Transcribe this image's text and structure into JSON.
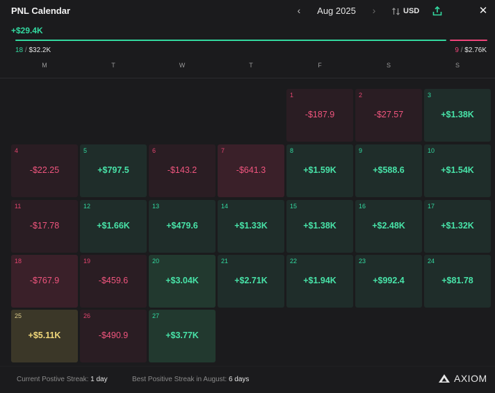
{
  "header": {
    "title": "PNL Calendar",
    "month": "Aug 2025",
    "prev_icon": "chevron-left-icon",
    "next_icon": "chevron-right-icon",
    "currency": "USD",
    "close_icon": "close-icon"
  },
  "summary": {
    "total": "+$29.4K",
    "win_days": "18",
    "win_amount": "$32.2K",
    "loss_days": "9",
    "loss_amount": "$2.76K",
    "sep": " / "
  },
  "weekdays": [
    "M",
    "T",
    "W",
    "T",
    "F",
    "S",
    "S"
  ],
  "days": [
    {
      "day": "1",
      "value": "-$187.9",
      "type": "neg"
    },
    {
      "day": "2",
      "value": "-$27.57",
      "type": "neg"
    },
    {
      "day": "3",
      "value": "+$1.38K",
      "type": "pos"
    },
    {
      "day": "4",
      "value": "-$22.25",
      "type": "neg"
    },
    {
      "day": "5",
      "value": "+$797.5",
      "type": "pos"
    },
    {
      "day": "6",
      "value": "-$143.2",
      "type": "neg"
    },
    {
      "day": "7",
      "value": "-$641.3",
      "type": "neg-strong"
    },
    {
      "day": "8",
      "value": "+$1.59K",
      "type": "pos"
    },
    {
      "day": "9",
      "value": "+$588.6",
      "type": "pos"
    },
    {
      "day": "10",
      "value": "+$1.54K",
      "type": "pos"
    },
    {
      "day": "11",
      "value": "-$17.78",
      "type": "neg"
    },
    {
      "day": "12",
      "value": "+$1.66K",
      "type": "pos"
    },
    {
      "day": "13",
      "value": "+$479.6",
      "type": "pos"
    },
    {
      "day": "14",
      "value": "+$1.33K",
      "type": "pos"
    },
    {
      "day": "15",
      "value": "+$1.38K",
      "type": "pos"
    },
    {
      "day": "16",
      "value": "+$2.48K",
      "type": "pos"
    },
    {
      "day": "17",
      "value": "+$1.32K",
      "type": "pos"
    },
    {
      "day": "18",
      "value": "-$767.9",
      "type": "neg-strong"
    },
    {
      "day": "19",
      "value": "-$459.6",
      "type": "neg"
    },
    {
      "day": "20",
      "value": "+$3.04K",
      "type": "pos-strong"
    },
    {
      "day": "21",
      "value": "+$2.71K",
      "type": "pos"
    },
    {
      "day": "22",
      "value": "+$1.94K",
      "type": "pos"
    },
    {
      "day": "23",
      "value": "+$992.4",
      "type": "pos"
    },
    {
      "day": "24",
      "value": "+$81.78",
      "type": "pos"
    },
    {
      "day": "25",
      "value": "+$5.11K",
      "type": "best"
    },
    {
      "day": "26",
      "value": "-$490.9",
      "type": "neg"
    },
    {
      "day": "27",
      "value": "+$3.77K",
      "type": "pos-strong"
    }
  ],
  "footer": {
    "current_streak_label": "Current Postive Streak: ",
    "current_streak_value": "1 day",
    "best_streak_label": "Best Positive Streak in August: ",
    "best_streak_value": "6 days",
    "brand": "AXIOM"
  },
  "colors": {
    "positive": "#33d9a0",
    "negative": "#f0447a",
    "best": "#f0d77a",
    "background": "#1b1b1d"
  }
}
